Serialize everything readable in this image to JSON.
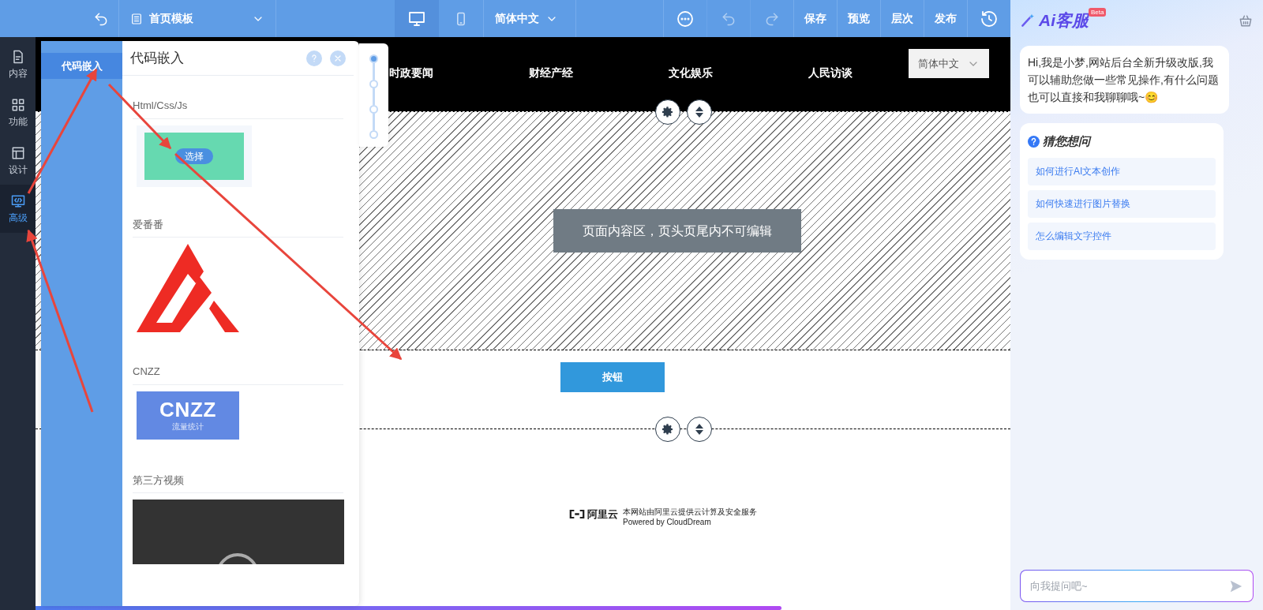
{
  "toolbar": {
    "template": "首页模板",
    "language": "简体中文",
    "devices": [
      {
        "kind": "desktop",
        "selected": true
      },
      {
        "kind": "mobile",
        "selected": false
      }
    ],
    "actions": [
      "保存",
      "预览",
      "层次",
      "发布"
    ]
  },
  "sidebar": {
    "items": [
      {
        "kind": "content",
        "label": "内容",
        "selected": false
      },
      {
        "kind": "apps",
        "label": "功能",
        "selected": false
      },
      {
        "kind": "design",
        "label": "设计",
        "selected": false
      },
      {
        "kind": "code",
        "label": "高级",
        "selected": true
      }
    ]
  },
  "panel": {
    "tabs": [
      {
        "label": "代码嵌入",
        "selected": true
      }
    ],
    "title": "代码嵌入",
    "sections": [
      {
        "kind": "code",
        "title": "Html/Css/Js",
        "button": "选择"
      },
      {
        "kind": "brand",
        "title": "爱番番"
      },
      {
        "kind": "cnzz",
        "title": "CNZZ",
        "logo_text": "CNZZ",
        "logo_subtext": "流量统计"
      },
      {
        "kind": "video",
        "title": "第三方视频"
      }
    ],
    "steps": [
      {
        "selected": true
      },
      {
        "selected": false
      },
      {
        "selected": false
      },
      {
        "selected": false
      }
    ]
  },
  "canvas": {
    "progress": {
      "level": 0.765
    },
    "nav": [
      "时政要闻",
      "财经产经",
      "文化娱乐",
      "人民访谈"
    ],
    "language_select": "简体中文",
    "notice": "页面内容区，页头页尾内不可编辑",
    "button": "按钮",
    "footer_brand": "阿里云",
    "footer_line": "本网站由阿里云提供云计算及安全服务",
    "footer_powered": "Powered by CloudDream"
  },
  "assistant": {
    "title": "Ai客服",
    "badge": "Beta",
    "greeting": "Hi,我是小梦,网站后台全新升级改版,我可以辅助您做一些常见操作,有什么问题也可以直接和我聊聊哦~😊",
    "suggest_title": "猜您想问",
    "suggestions": [
      "如何进行AI文本创作",
      "如何快速进行图片替换",
      "怎么编辑文字控件"
    ],
    "input_placeholder": "向我提问吧~"
  }
}
